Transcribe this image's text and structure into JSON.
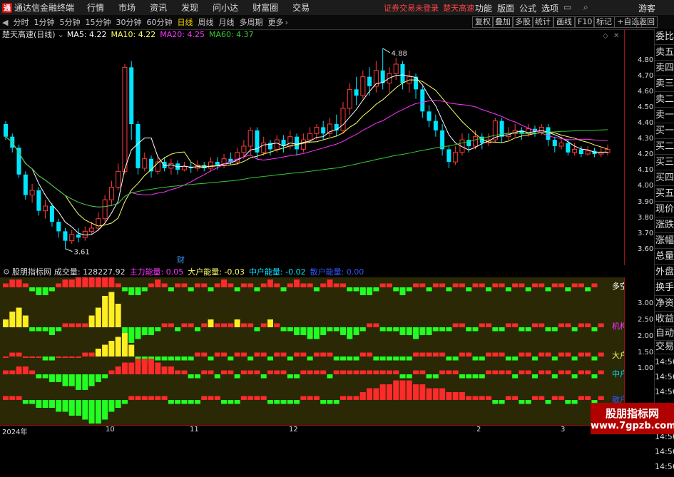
{
  "app": {
    "title": "通达信金融终端",
    "logo": "通"
  },
  "menu": [
    "行情",
    "市场",
    "资讯",
    "发现",
    "问小达",
    "财富圈",
    "交易"
  ],
  "warning": {
    "login": "证券交易未登录",
    "stock": "楚天高速"
  },
  "right_menu": [
    "功能",
    "版面",
    "公式",
    "选项"
  ],
  "user": "游客",
  "toolbar": {
    "periods": [
      "分时",
      "1分钟",
      "5分钟",
      "15分钟",
      "30分钟",
      "60分钟",
      "日线",
      "周线",
      "月线",
      "多周期",
      "更多"
    ],
    "active": "日线",
    "right": [
      "复权",
      "叠加",
      "多股",
      "统计",
      "画线",
      "F10",
      "标记",
      "+自选",
      "返回"
    ]
  },
  "chart_info": {
    "stock": "楚天高速(日线)",
    "ma5": "MA5: 4.22",
    "ma10": "MA10: 4.22",
    "ma20": "MA20: 4.25",
    "ma60": "MA60: 4.37"
  },
  "colors": {
    "up": "#ff3b3b",
    "down": "#00e5ff",
    "ma5": "#ffffff",
    "ma10": "#ffff66",
    "ma20": "#ff33ff",
    "ma60": "#33cc33"
  },
  "price_axis": [
    "4.80",
    "4.70",
    "4.60",
    "4.50",
    "4.40",
    "4.30",
    "4.20",
    "4.10",
    "4.00",
    "3.90",
    "3.80",
    "3.70",
    "3.60"
  ],
  "annotations": {
    "high": "4.88",
    "low": "3.61",
    "fin": "财"
  },
  "indicator": {
    "name": "股朋指标网",
    "volume": "成交量: 128227.92",
    "main": "主力能量: 0.05",
    "big": "大户能量: -0.03",
    "mid": "中户能量: -0.02",
    "retail": "散户能量: 0.00",
    "labels": [
      "多空",
      "机构",
      "大户",
      "中户",
      "散户"
    ]
  },
  "ind_axis": [
    "3.00",
    "2.50",
    "2.00",
    "1.50",
    "1.00"
  ],
  "side_panel": [
    "委比",
    "卖五",
    "卖四",
    "卖三",
    "卖二",
    "卖一",
    "买一",
    "买二",
    "买三",
    "买四",
    "买五",
    "现价",
    "涨跌",
    "涨幅",
    "总量",
    "外盘",
    "换手",
    "净资",
    "收益",
    "自动",
    "交易"
  ],
  "right_times": [
    "14:56",
    "14:56",
    "14:56",
    "14:56",
    "14:56",
    "14:56",
    "14:56",
    "14:56"
  ],
  "time_axis": [
    "2024年",
    "10",
    "11",
    "12",
    "2",
    "3"
  ],
  "watermark": {
    "line1": "股朋指标网",
    "line2": "www.7gpzb.com"
  },
  "chart_data": {
    "type": "candlestick",
    "ylim": [
      3.55,
      4.92
    ],
    "candles": [
      [
        4.4,
        4.32,
        4.42,
        4.3
      ],
      [
        4.32,
        4.25,
        4.34,
        4.22
      ],
      [
        4.25,
        4.08,
        4.27,
        4.06
      ],
      [
        4.08,
        3.95,
        4.1,
        3.92
      ],
      [
        3.95,
        3.98,
        4.02,
        3.9
      ],
      [
        3.98,
        3.85,
        4.0,
        3.82
      ],
      [
        3.85,
        3.88,
        3.92,
        3.8
      ],
      [
        3.88,
        3.78,
        3.9,
        3.75
      ],
      [
        3.78,
        3.72,
        3.8,
        3.68
      ],
      [
        3.72,
        3.66,
        3.74,
        3.61
      ],
      [
        3.66,
        3.7,
        3.73,
        3.64
      ],
      [
        3.7,
        3.68,
        3.74,
        3.65
      ],
      [
        3.68,
        3.72,
        3.75,
        3.66
      ],
      [
        3.72,
        3.74,
        3.78,
        3.7
      ],
      [
        3.74,
        3.8,
        3.84,
        3.72
      ],
      [
        3.8,
        3.92,
        3.95,
        3.78
      ],
      [
        3.92,
        4.0,
        4.04,
        3.88
      ],
      [
        4.0,
        4.1,
        4.15,
        3.98
      ],
      [
        4.1,
        4.76,
        4.78,
        4.08
      ],
      [
        4.76,
        4.4,
        4.8,
        4.3
      ],
      [
        4.4,
        4.12,
        4.42,
        4.08
      ],
      [
        4.12,
        4.18,
        4.22,
        4.1
      ],
      [
        4.18,
        4.1,
        4.2,
        4.06
      ],
      [
        4.1,
        4.16,
        4.2,
        4.08
      ],
      [
        4.16,
        4.12,
        4.19,
        4.1
      ],
      [
        4.12,
        4.15,
        4.18,
        4.08
      ],
      [
        4.15,
        4.11,
        4.17,
        4.08
      ],
      [
        4.11,
        4.13,
        4.16,
        4.1
      ],
      [
        4.13,
        4.12,
        4.16,
        4.09
      ],
      [
        4.12,
        4.14,
        4.17,
        4.1
      ],
      [
        4.14,
        4.12,
        4.16,
        4.1
      ],
      [
        4.12,
        4.16,
        4.19,
        4.1
      ],
      [
        4.16,
        4.14,
        4.19,
        4.11
      ],
      [
        4.14,
        4.18,
        4.21,
        4.12
      ],
      [
        4.18,
        4.16,
        4.22,
        4.14
      ],
      [
        4.16,
        4.22,
        4.25,
        4.14
      ],
      [
        4.22,
        4.26,
        4.3,
        4.18
      ],
      [
        4.26,
        4.36,
        4.38,
        4.2
      ],
      [
        4.36,
        4.22,
        4.38,
        4.18
      ],
      [
        4.22,
        4.28,
        4.32,
        4.2
      ],
      [
        4.28,
        4.24,
        4.3,
        4.2
      ],
      [
        4.24,
        4.3,
        4.33,
        4.22
      ],
      [
        4.3,
        4.26,
        4.33,
        4.22
      ],
      [
        4.26,
        4.32,
        4.36,
        4.24
      ],
      [
        4.32,
        4.24,
        4.34,
        4.2
      ],
      [
        4.24,
        4.3,
        4.34,
        4.22
      ],
      [
        4.3,
        4.34,
        4.38,
        4.28
      ],
      [
        4.34,
        4.38,
        4.4,
        4.3
      ],
      [
        4.38,
        4.34,
        4.42,
        4.3
      ],
      [
        4.34,
        4.4,
        4.44,
        4.32
      ],
      [
        4.4,
        4.36,
        4.46,
        4.32
      ],
      [
        4.36,
        4.5,
        4.54,
        4.34
      ],
      [
        4.5,
        4.62,
        4.66,
        4.46
      ],
      [
        4.62,
        4.58,
        4.7,
        4.52
      ],
      [
        4.58,
        4.7,
        4.74,
        4.56
      ],
      [
        4.7,
        4.64,
        4.76,
        4.58
      ],
      [
        4.64,
        4.74,
        4.8,
        4.6
      ],
      [
        4.74,
        4.66,
        4.88,
        4.62
      ],
      [
        4.66,
        4.72,
        4.76,
        4.6
      ],
      [
        4.72,
        4.78,
        4.82,
        4.68
      ],
      [
        4.78,
        4.66,
        4.8,
        4.62
      ],
      [
        4.66,
        4.7,
        4.74,
        4.6
      ],
      [
        4.7,
        4.62,
        4.72,
        4.56
      ],
      [
        4.62,
        4.48,
        4.64,
        4.44
      ],
      [
        4.48,
        4.42,
        4.52,
        4.38
      ],
      [
        4.42,
        4.36,
        4.46,
        4.32
      ],
      [
        4.36,
        4.24,
        4.4,
        4.2
      ],
      [
        4.24,
        4.16,
        4.26,
        4.12
      ],
      [
        4.16,
        4.22,
        4.26,
        4.14
      ],
      [
        4.22,
        4.3,
        4.34,
        4.2
      ],
      [
        4.3,
        4.26,
        4.34,
        4.22
      ],
      [
        4.26,
        4.32,
        4.36,
        4.24
      ],
      [
        4.32,
        4.28,
        4.34,
        4.24
      ],
      [
        4.28,
        4.3,
        4.34,
        4.26
      ],
      [
        4.3,
        4.42,
        4.44,
        4.28
      ],
      [
        4.42,
        4.32,
        4.44,
        4.28
      ],
      [
        4.32,
        4.34,
        4.38,
        4.3
      ],
      [
        4.34,
        4.36,
        4.4,
        4.32
      ],
      [
        4.36,
        4.34,
        4.38,
        4.3
      ],
      [
        4.34,
        4.37,
        4.4,
        4.32
      ],
      [
        4.37,
        4.35,
        4.39,
        4.32
      ],
      [
        4.35,
        4.38,
        4.4,
        4.33
      ],
      [
        4.38,
        4.3,
        4.4,
        4.26
      ],
      [
        4.3,
        4.26,
        4.32,
        4.22
      ],
      [
        4.26,
        4.28,
        4.32,
        4.24
      ],
      [
        4.28,
        4.22,
        4.3,
        4.2
      ],
      [
        4.22,
        4.24,
        4.28,
        4.2
      ],
      [
        4.24,
        4.21,
        4.26,
        4.19
      ],
      [
        4.21,
        4.23,
        4.26,
        4.2
      ],
      [
        4.23,
        4.21,
        4.25,
        4.19
      ],
      [
        4.21,
        4.22,
        4.25,
        4.19
      ],
      [
        4.22,
        4.24,
        4.27,
        4.2
      ]
    ],
    "indicator_series": {
      "duokong": [
        1,
        2,
        2,
        1,
        -1,
        -2,
        -2,
        -1,
        1,
        2,
        2,
        3,
        4,
        5,
        6,
        7,
        3,
        1,
        -1,
        -2,
        -2,
        -1,
        1,
        2,
        1,
        -1,
        1,
        1,
        -1,
        1,
        1,
        -1,
        1,
        2,
        1,
        -1,
        1,
        1,
        -1,
        1,
        2,
        1,
        -1,
        1,
        2,
        1,
        1,
        -1,
        1,
        2,
        1,
        1,
        -1,
        -1,
        -2,
        -2,
        -1,
        1,
        1,
        -1,
        -2,
        -1,
        1,
        1,
        -1,
        1,
        1,
        -1,
        1,
        1,
        -1,
        1,
        1,
        -1,
        1,
        1,
        -1,
        1,
        1,
        -1,
        1,
        1,
        -1,
        1,
        1,
        -1,
        1,
        1,
        -1,
        1
      ],
      "jigou": [
        2,
        4,
        5,
        3,
        -1,
        -1,
        -1,
        -2,
        -1,
        1,
        1,
        1,
        1,
        3,
        5,
        8,
        9,
        6,
        -3,
        -4,
        -3,
        -2,
        -2,
        -1,
        1,
        1,
        -1,
        1,
        1,
        -1,
        1,
        2,
        1,
        1,
        1,
        2,
        1,
        1,
        -1,
        1,
        2,
        1,
        -1,
        -1,
        -2,
        -2,
        -3,
        -3,
        -2,
        -1,
        -1,
        -2,
        -3,
        -2,
        -1,
        1,
        1,
        -1,
        -1,
        -1,
        -2,
        -2,
        -3,
        -2,
        -2,
        -1,
        -1,
        -1,
        1,
        1,
        -1,
        -1,
        1,
        1,
        -1,
        -1,
        1,
        1,
        -1,
        -1,
        1,
        1,
        -1,
        -1,
        1,
        1,
        -1,
        1,
        1,
        -1,
        1
      ],
      "dahu": [
        0,
        1,
        1,
        0,
        0,
        0,
        -1,
        -1,
        0,
        0,
        0,
        0,
        1,
        1,
        2,
        3,
        4,
        5,
        6,
        3,
        -2,
        -2,
        -2,
        -1,
        -1,
        -1,
        -1,
        -1,
        -1,
        1,
        1,
        -1,
        1,
        1,
        -1,
        1,
        1,
        -1,
        1,
        1,
        -1,
        1,
        1,
        -1,
        1,
        1,
        -1,
        1,
        1,
        1,
        -1,
        -1,
        -1,
        -1,
        1,
        1,
        -1,
        -1,
        -1,
        -1,
        -1,
        -1,
        1,
        1,
        1,
        1,
        1,
        -1,
        -1,
        1,
        1,
        -1,
        -1,
        1,
        1,
        1,
        -1,
        -1,
        1,
        1,
        -1,
        1,
        1,
        -1,
        1,
        1,
        -1,
        1,
        1,
        -1,
        1
      ],
      "zhonghu": [
        1,
        1,
        2,
        2,
        1,
        -1,
        -1,
        -2,
        -2,
        -3,
        -3,
        -4,
        -4,
        -3,
        -2,
        -1,
        1,
        2,
        3,
        3,
        4,
        4,
        4,
        3,
        2,
        2,
        1,
        1,
        -1,
        -1,
        1,
        1,
        -1,
        1,
        1,
        -1,
        1,
        1,
        1,
        -1,
        1,
        1,
        1,
        -1,
        -1,
        1,
        1,
        1,
        1,
        -1,
        1,
        1,
        1,
        1,
        1,
        1,
        1,
        1,
        1,
        1,
        -1,
        -1,
        1,
        1,
        -1,
        -1,
        1,
        1,
        1,
        -1,
        -1,
        -1,
        -1,
        1,
        1,
        1,
        1,
        -1,
        1,
        1,
        -1,
        1,
        1,
        -1,
        1,
        1,
        -1,
        1,
        1,
        -1,
        1
      ],
      "sanhu": [
        1,
        1,
        1,
        -1,
        -1,
        -2,
        -2,
        -2,
        -3,
        -3,
        -4,
        -4,
        -5,
        -6,
        -6,
        -5,
        -3,
        -2,
        -1,
        1,
        1,
        1,
        1,
        1,
        1,
        -1,
        -1,
        -1,
        -1,
        -1,
        1,
        1,
        1,
        -1,
        -1,
        -1,
        1,
        1,
        1,
        1,
        -1,
        -1,
        -1,
        -1,
        -1,
        1,
        1,
        1,
        -1,
        -1,
        -1,
        1,
        1,
        1,
        2,
        3,
        3,
        4,
        4,
        5,
        5,
        5,
        4,
        4,
        3,
        3,
        3,
        2,
        2,
        2,
        1,
        1,
        1,
        1,
        -1,
        -1,
        1,
        1,
        -1,
        -1,
        1,
        1,
        -1,
        1,
        1,
        -1,
        -1,
        1,
        1,
        -1,
        1
      ]
    }
  }
}
